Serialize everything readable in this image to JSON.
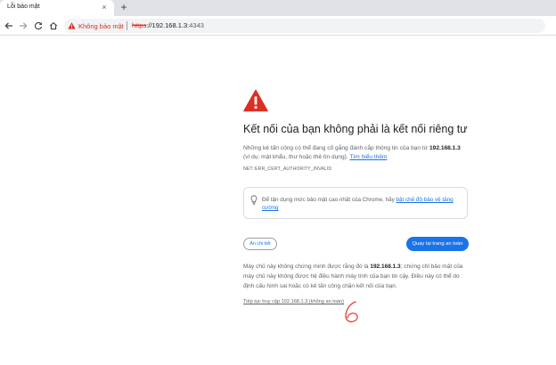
{
  "tab": {
    "title": "Lỗi bảo mật",
    "close": "×",
    "new_tab": "+"
  },
  "toolbar": {
    "security_chip": "Không bảo mật",
    "url_scheme": "https",
    "url_rest": "://192.168.1.3",
    "url_port": ":4343"
  },
  "interstitial": {
    "heading": "Kết nối của bạn không phải là kết nối riêng tư",
    "para1_pre": "Những kẻ tấn công có thể đang cố gắng đánh cắp thông tin của bạn từ ",
    "para1_host": "192.168.1.3",
    "para1_post": " (ví dụ: mật khẩu, thư hoặc thẻ tín dụng). ",
    "learn_more": "Tìm hiểu thêm",
    "error_code": "NET::ERR_CERT_AUTHORITY_INVALID",
    "enhance_pre": "Để tận dụng mức bảo mật cao nhất của Chrome, hãy ",
    "enhance_link": "bật chế độ bảo vệ tăng cường",
    "advanced_button": "Ẩn chi tiết",
    "back_button": "Quay lại trang an toàn",
    "para2_pre": "Máy chủ này không chứng minh được rằng đó là ",
    "para2_host": "192.168.1.3",
    "para2_post": "; chứng chỉ bảo mật của máy chủ này không được hệ điều hành máy tính của bạn tin cậy. Điều này có thể do định cấu hình sai hoặc có kẻ tấn công chặn kết nối của bạn.",
    "proceed_link": "Tiếp tục truy cập 192.168.1.3 (không an toàn)"
  },
  "colors": {
    "danger": "#d93025",
    "accent": "#1a73e8",
    "annotation": "#e53935"
  },
  "icons": [
    "back-arrow-icon",
    "forward-arrow-icon",
    "reload-icon",
    "home-icon",
    "warning-triangle-icon",
    "lightbulb-icon"
  ]
}
